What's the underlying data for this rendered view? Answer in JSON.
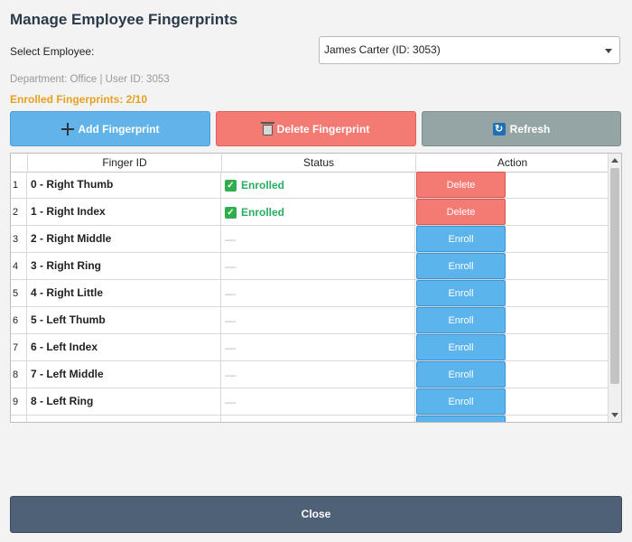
{
  "dialog": {
    "title": "Manage Employee Fingerprints",
    "select_label": "Select Employee:",
    "selected_employee": "James Carter (ID: 3053)",
    "info": "Department: Office | User ID: 3053",
    "enrolled_count": "Enrolled Fingerprints: 2/10",
    "close_label": "Close"
  },
  "toolbar": {
    "add_label": "Add Fingerprint",
    "delete_label": "Delete Fingerprint",
    "refresh_label": "Refresh"
  },
  "grid": {
    "columns": [
      "Finger ID",
      "Status",
      "Action"
    ],
    "rows": [
      {
        "num": "1",
        "finger": "0 - Right Thumb",
        "status": "Enrolled",
        "enrolled": true,
        "action": "Delete"
      },
      {
        "num": "2",
        "finger": "1 - Right Index",
        "status": "Enrolled",
        "enrolled": true,
        "action": "Delete"
      },
      {
        "num": "3",
        "finger": "2 - Right Middle",
        "status": "—",
        "enrolled": false,
        "action": "Enroll"
      },
      {
        "num": "4",
        "finger": "3 - Right Ring",
        "status": "—",
        "enrolled": false,
        "action": "Enroll"
      },
      {
        "num": "5",
        "finger": "4 - Right Little",
        "status": "—",
        "enrolled": false,
        "action": "Enroll"
      },
      {
        "num": "6",
        "finger": "5 - Left Thumb",
        "status": "—",
        "enrolled": false,
        "action": "Enroll"
      },
      {
        "num": "7",
        "finger": "6 - Left Index",
        "status": "—",
        "enrolled": false,
        "action": "Enroll"
      },
      {
        "num": "8",
        "finger": "7 - Left Middle",
        "status": "—",
        "enrolled": false,
        "action": "Enroll"
      },
      {
        "num": "9",
        "finger": "8 - Left Ring",
        "status": "—",
        "enrolled": false,
        "action": "Enroll"
      },
      {
        "num": "",
        "finger": "",
        "status": "",
        "enrolled": false,
        "action": ""
      }
    ]
  },
  "colors": {
    "add": "#62b3ea",
    "delete": "#f47a74",
    "refresh": "#95a5a6",
    "close": "#4e6177",
    "enrolled_text": "#27ae60",
    "count_text": "#e8a020"
  }
}
